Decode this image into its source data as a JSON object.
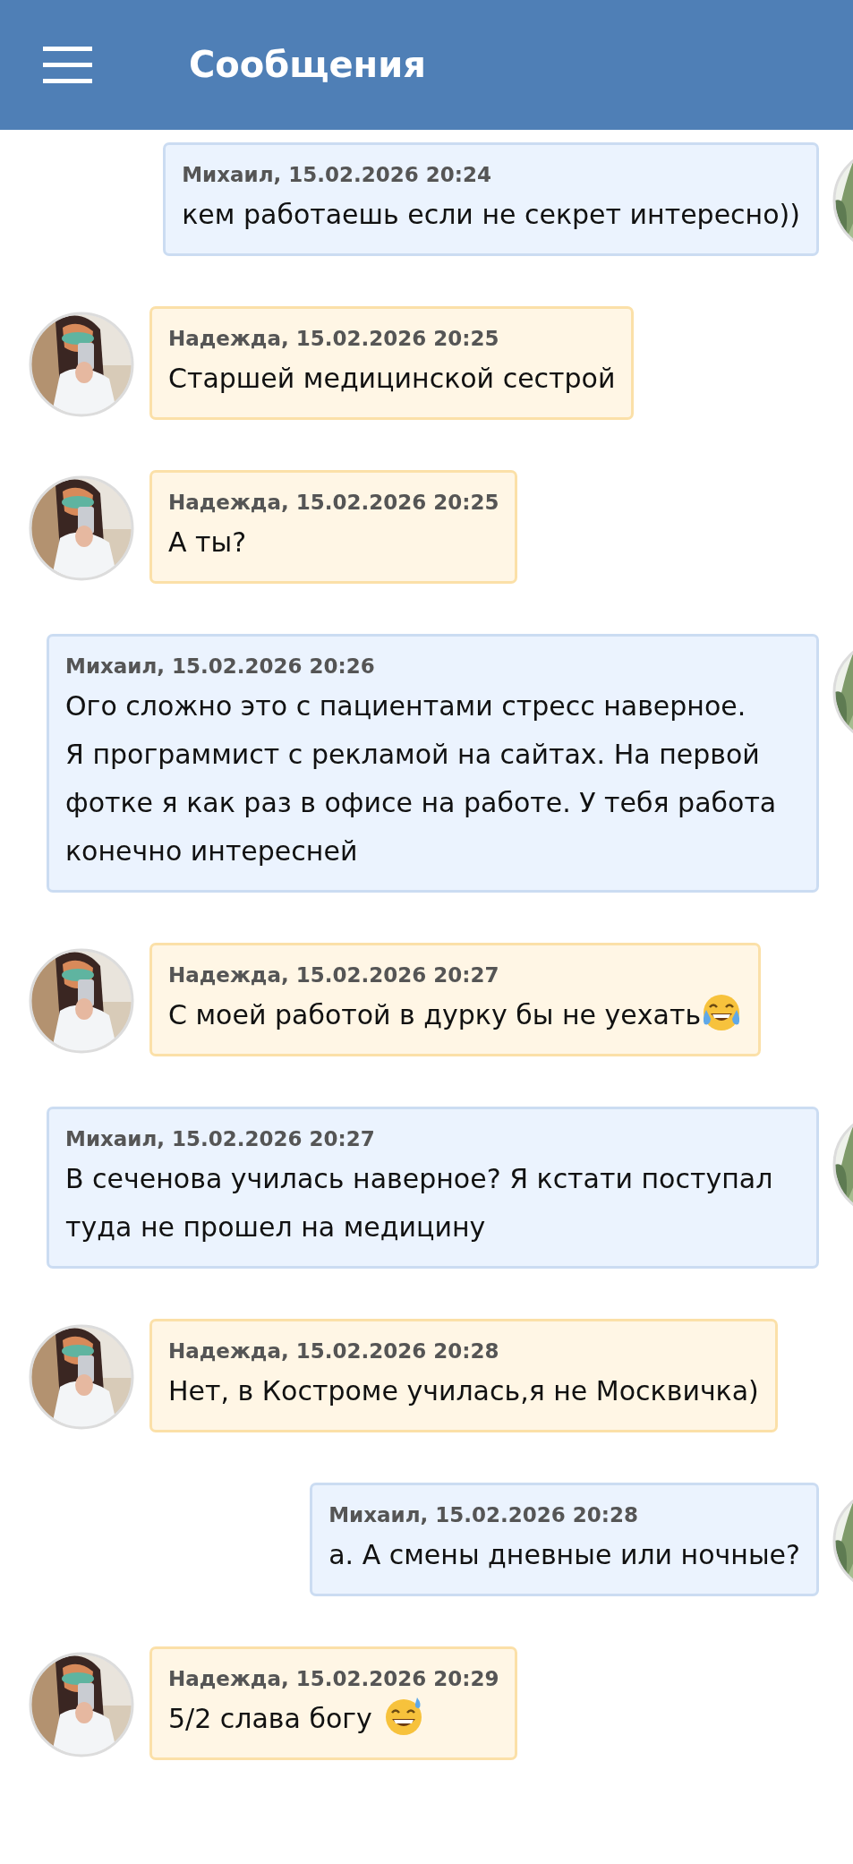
{
  "header": {
    "title": "Сообщения"
  },
  "messages": [
    {
      "kind": "outgoing",
      "meta": "Михаил, 15.02.2026 20:24",
      "text": "кем работаешь если не секрет интересно))"
    },
    {
      "kind": "incoming",
      "meta": "Надежда, 15.02.2026 20:25",
      "text": "Старшей медицинской сестрой"
    },
    {
      "kind": "incoming",
      "meta": "Надежда, 15.02.2026 20:25",
      "text": "А ты?"
    },
    {
      "kind": "outgoing",
      "meta": "Михаил, 15.02.2026 20:26",
      "text": "Ого сложно это с пациентами стресс наверное.\nЯ программист с рекламой на сайтах. На первой фотке я как раз в офисе на работе. У тебя работа конечно интересней"
    },
    {
      "kind": "incoming",
      "meta": "Надежда, 15.02.2026 20:27",
      "text": "С моей работой в дурку бы не уехать",
      "emoji": {
        "kind": "laugh"
      }
    },
    {
      "kind": "outgoing",
      "meta": "Михаил, 15.02.2026 20:27",
      "text": "В сеченова училась наверное? Я кстати поступал туда не прошел на медицину"
    },
    {
      "kind": "incoming",
      "meta": "Надежда, 15.02.2026 20:28",
      "text": "Нет, в Костроме училась,я не Москвичка)"
    },
    {
      "kind": "outgoing",
      "meta": "Михаил, 15.02.2026 20:28",
      "text": "а. А смены дневные или ночные?"
    },
    {
      "kind": "incoming",
      "meta": "Надежда, 15.02.2026 20:29",
      "text": "5/2 слава богу",
      "emoji": {
        "kind": "sweat"
      }
    }
  ]
}
